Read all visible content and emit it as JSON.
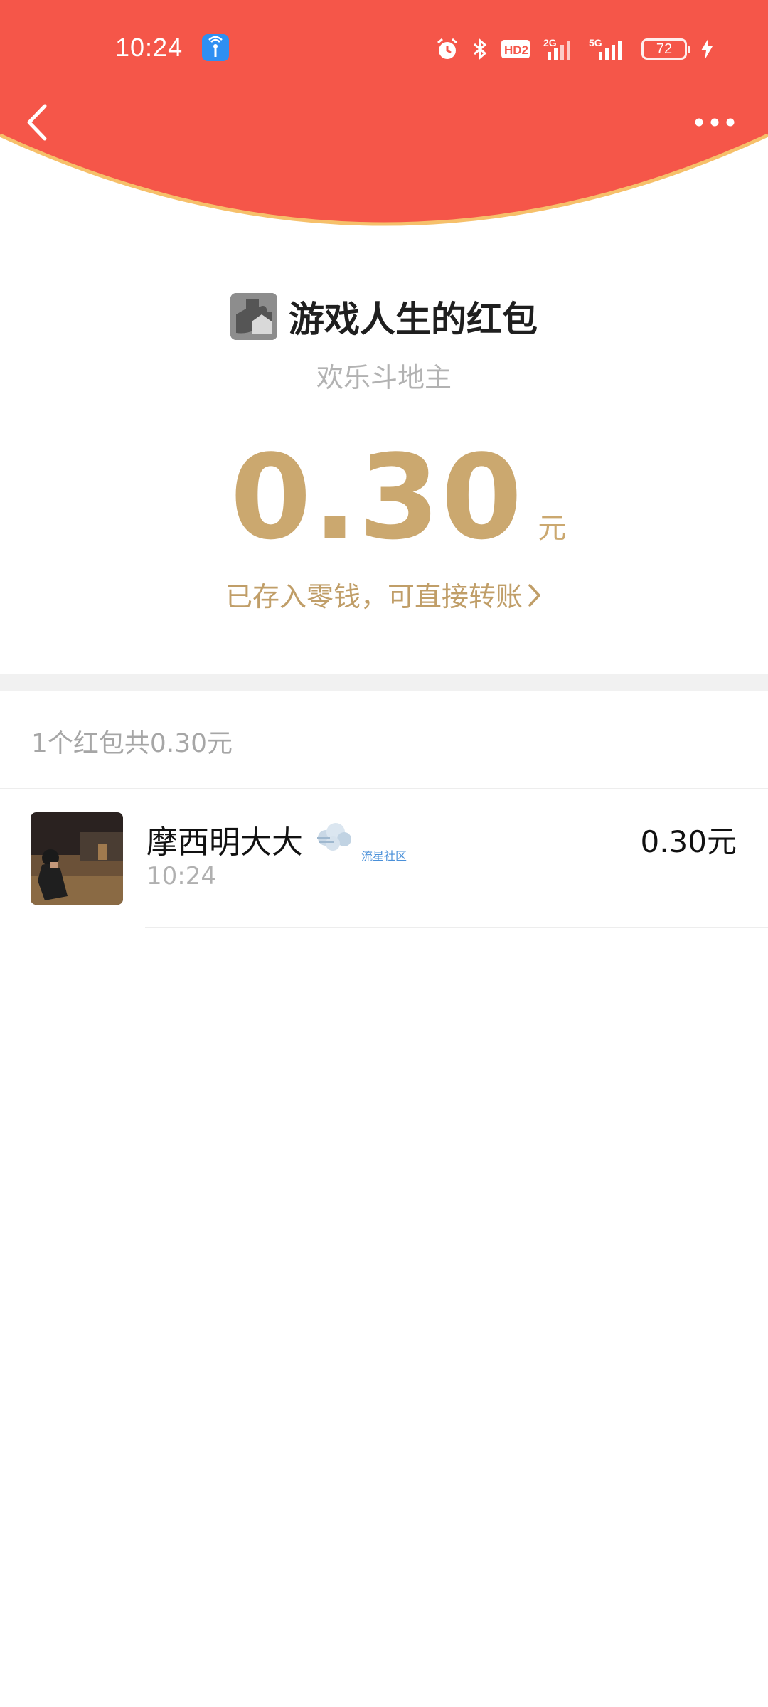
{
  "colors": {
    "header_red": "#f55649",
    "header_border": "#f6c06a",
    "gold": "#cba86f",
    "gray_text": "#b0b0b0"
  },
  "status_bar": {
    "time": "10:24",
    "battery_level": "72",
    "icons": [
      "app-notification-icon",
      "alarm-icon",
      "bluetooth-icon",
      "hd-icon",
      "signal-2g-icon",
      "signal-5g-icon",
      "battery-icon",
      "charging-icon"
    ],
    "hd_label": "HD2",
    "net1_label": "2G",
    "net2_label": "5G"
  },
  "nav": {
    "back_icon": "chevron-left-icon",
    "more_icon": "more-dots-icon"
  },
  "packet": {
    "title": "游戏人生的红包",
    "subtitle": "欢乐斗地主",
    "amount": "0.30",
    "unit": "元",
    "wallet_link": "已存入零钱，可直接转账"
  },
  "summary": {
    "text": "1个红包共0.30元"
  },
  "records": [
    {
      "name": "摩西明大大",
      "badge_text": "流星社区",
      "time": "10:24",
      "amount": "0.30元"
    }
  ]
}
